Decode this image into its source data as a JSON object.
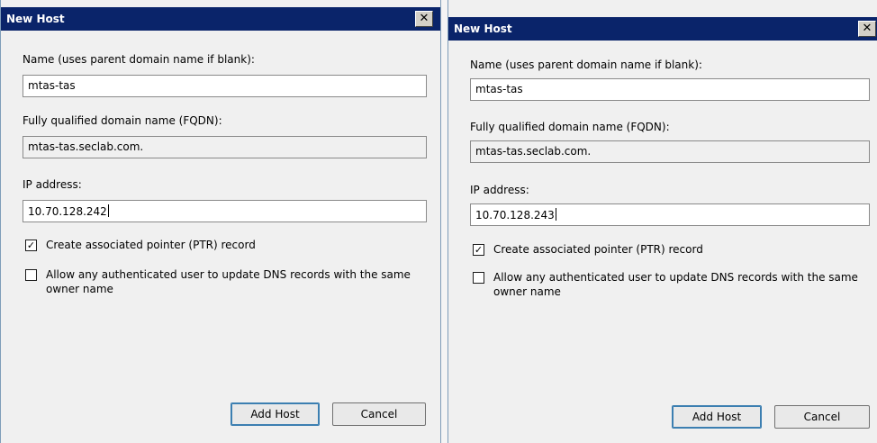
{
  "dialogs": [
    {
      "title": "New Host",
      "name_label": "Name (uses parent domain name if blank):",
      "name_value": "mtas-tas",
      "fqdn_label": "Fully qualified domain name (FQDN):",
      "fqdn_value": "mtas-tas.seclab.com.",
      "ip_label": "IP address:",
      "ip_value": "10.70.128.242",
      "ptr_checkbox_label": "Create associated pointer (PTR) record",
      "ptr_checked": true,
      "allow_update_label": "Allow any authenticated user to update DNS records with the same owner name",
      "allow_update_checked": false,
      "add_host_label": "Add Host",
      "cancel_label": "Cancel",
      "close_glyph": "✕"
    },
    {
      "title": "New Host",
      "name_label": "Name (uses parent domain name if blank):",
      "name_value": "mtas-tas",
      "fqdn_label": "Fully qualified domain name (FQDN):",
      "fqdn_value": "mtas-tas.seclab.com.",
      "ip_label": "IP address:",
      "ip_value": "10.70.128.243",
      "ptr_checkbox_label": "Create associated pointer (PTR) record",
      "ptr_checked": true,
      "allow_update_label": "Allow any authenticated user to update DNS records with the same owner name",
      "allow_update_checked": false,
      "add_host_label": "Add Host",
      "cancel_label": "Cancel",
      "close_glyph": "✕"
    }
  ],
  "colors": {
    "titlebar": "#0a246a",
    "dialog_bg": "#f0f0f0",
    "accent": "#3c7fb1"
  }
}
